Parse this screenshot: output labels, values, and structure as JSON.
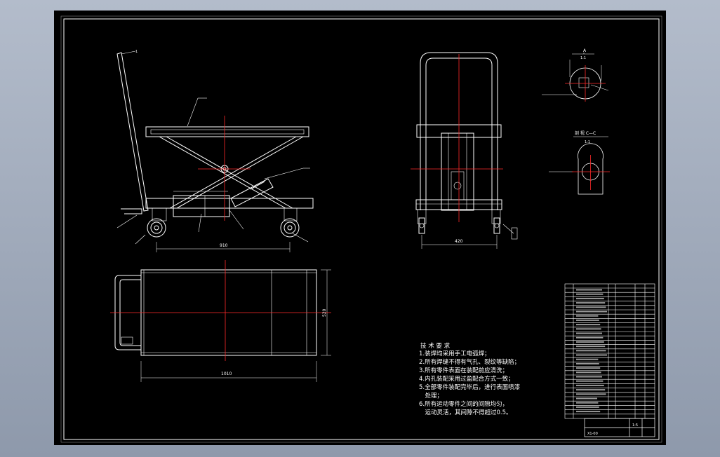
{
  "drawing": {
    "colors": {
      "background": "#000000",
      "lines": "#ffffff",
      "centerlines": "#ff2a2a",
      "outer_frame": "#b3bccb"
    },
    "dims": {
      "side_wheelbase": "910",
      "front_width": "420",
      "top_length": "1010",
      "top_width": "520"
    },
    "views": {
      "detail_a_title": "A",
      "detail_a_scale": "1:1",
      "section_title": "剖 视 C—C",
      "section_scale": "1:1"
    },
    "notes": {
      "heading": "技 术 要 求",
      "lines": [
        "1.装焊均采用手工电弧焊；",
        "2.所有焊缝不得有气孔、裂纹等缺陷；",
        "3.所有零件表面在装配前应清洗；",
        "4.内孔装配采用过盈配合方式一致；",
        "5.全部零件装配完毕后，进行表面喷漆",
        "　处理；",
        "6.所有运动零件之间的间隙均匀，",
        "　运动灵活，其间隙不得超过0.5。"
      ]
    },
    "title_block": {
      "drawing_no": "X1-00",
      "scale_text": "1:5"
    }
  }
}
